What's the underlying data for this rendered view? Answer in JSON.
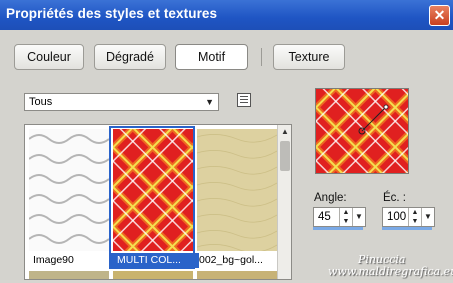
{
  "window": {
    "title": "Propriétés des styles et textures",
    "close_icon": "close-icon"
  },
  "tabs": [
    {
      "label": "Couleur",
      "active": false
    },
    {
      "label": "Dégradé",
      "active": false
    },
    {
      "label": "Motif",
      "active": true
    },
    {
      "label": "Texture",
      "active": false
    }
  ],
  "category": {
    "selected": "Tous"
  },
  "gallery": {
    "items": [
      {
        "caption": "Image90",
        "selected": false
      },
      {
        "caption": "MULTI COL...",
        "selected": true
      },
      {
        "caption": "002_bg~gol...",
        "selected": false
      }
    ]
  },
  "controls": {
    "angle_label": "Angle:",
    "angle_value": "45",
    "scale_label": "Éc. :",
    "scale_value": "100"
  },
  "watermark": {
    "line1": "Pinuccia",
    "line2": "www.maldiregrafica.eu"
  },
  "colors": {
    "titlebar": "#2458c8",
    "selection": "#2a63c9",
    "plaid_red": "#e02020",
    "plaid_yellow": "#f4e050"
  }
}
